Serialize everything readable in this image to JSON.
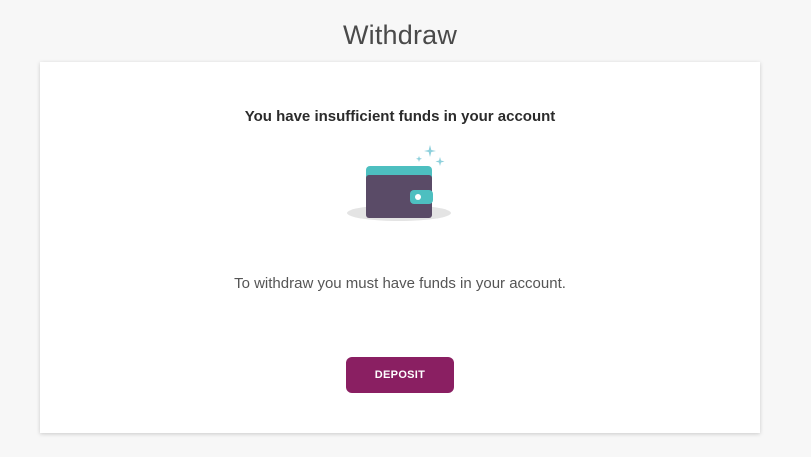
{
  "page": {
    "title": "Withdraw"
  },
  "card": {
    "heading": "You have insufficient funds in your account",
    "message": "To withdraw you must have funds in your account.",
    "deposit_label": "DEPOSIT"
  },
  "icons": {
    "illustration": "wallet-icon"
  },
  "colors": {
    "accent": "#8a1f62",
    "wallet_body": "#5a4b67",
    "wallet_top": "#4dbfc0",
    "sparkle": "#8ed0dc"
  }
}
